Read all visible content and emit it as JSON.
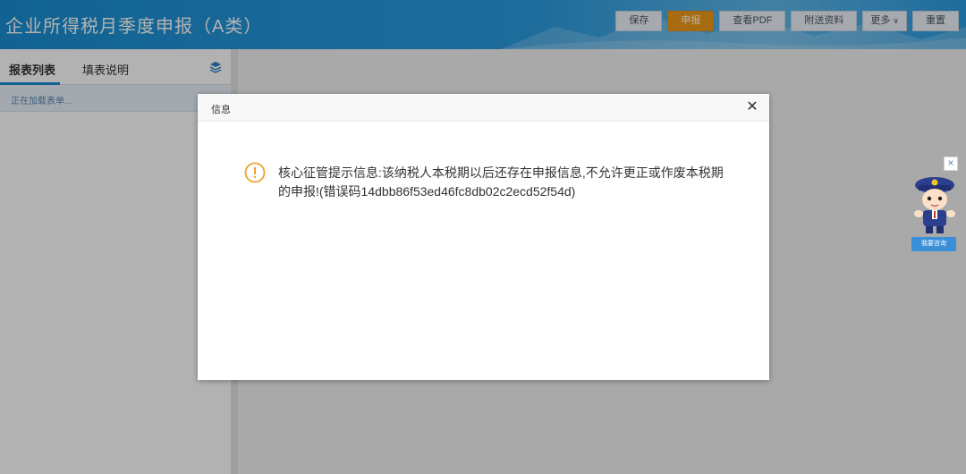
{
  "header": {
    "title": "企业所得税月季度申报（A类）",
    "buttons": {
      "save": "保存",
      "declare": "申报",
      "view_pdf": "查看PDF",
      "attachments": "附送资料",
      "more": "更多",
      "reset": "重置"
    }
  },
  "left_panel": {
    "tabs": [
      "报表列表",
      "填表说明"
    ],
    "loading_text": "正在加载表单..."
  },
  "dialog": {
    "title": "信息",
    "message": "核心征管提示信息:该纳税人本税期以后还存在申报信息,不允许更正或作废本税期的申报!(错误码14dbb86f53ed46fc8db02c2ecd52f54d)"
  },
  "assistant": {
    "button_label": "我要咨询"
  },
  "colors": {
    "header_blue": "#1a8fd3",
    "primary_orange": "#f09a1a",
    "warning": "#f0a030"
  }
}
